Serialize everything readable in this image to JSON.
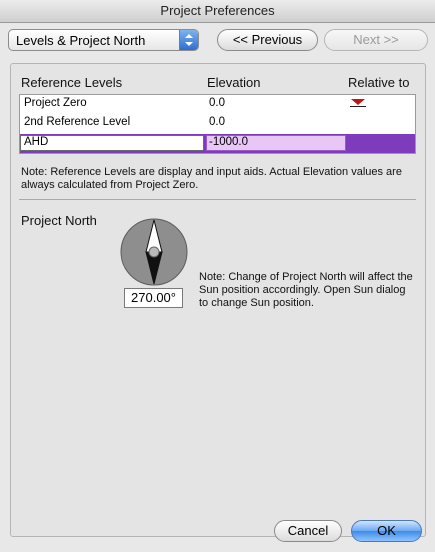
{
  "window": {
    "title": "Project Preferences"
  },
  "toolbar": {
    "section_select": "Levels & Project North",
    "previous_label": "<< Previous",
    "next_label": "Next >>"
  },
  "reference_levels": {
    "headers": {
      "name": "Reference Levels",
      "elevation": "Elevation",
      "relative": "Relative to"
    },
    "rows": [
      {
        "name": "Project Zero",
        "elevation": "0.0"
      },
      {
        "name": "2nd Reference Level",
        "elevation": "0.0"
      },
      {
        "name": "AHD",
        "elevation": "-1000.0"
      }
    ],
    "note": "Note: Reference Levels are display and input aids. Actual Elevation values are always calculated from Project Zero."
  },
  "project_north": {
    "label": "Project North",
    "angle": "270.00°",
    "note": "Note: Change of Project North will affect the Sun position accordingly. Open Sun dialog to change Sun position."
  },
  "footer": {
    "cancel_label": "Cancel",
    "ok_label": "OK"
  },
  "colors": {
    "selection": "#7e3bbb",
    "edit_highlight": "#e8c6f5",
    "default_button": "#3e8be8",
    "arrow_marker": "#c0141b"
  },
  "icons": [
    "updown-arrows-icon",
    "down-triangle-icon",
    "compass-icon"
  ]
}
